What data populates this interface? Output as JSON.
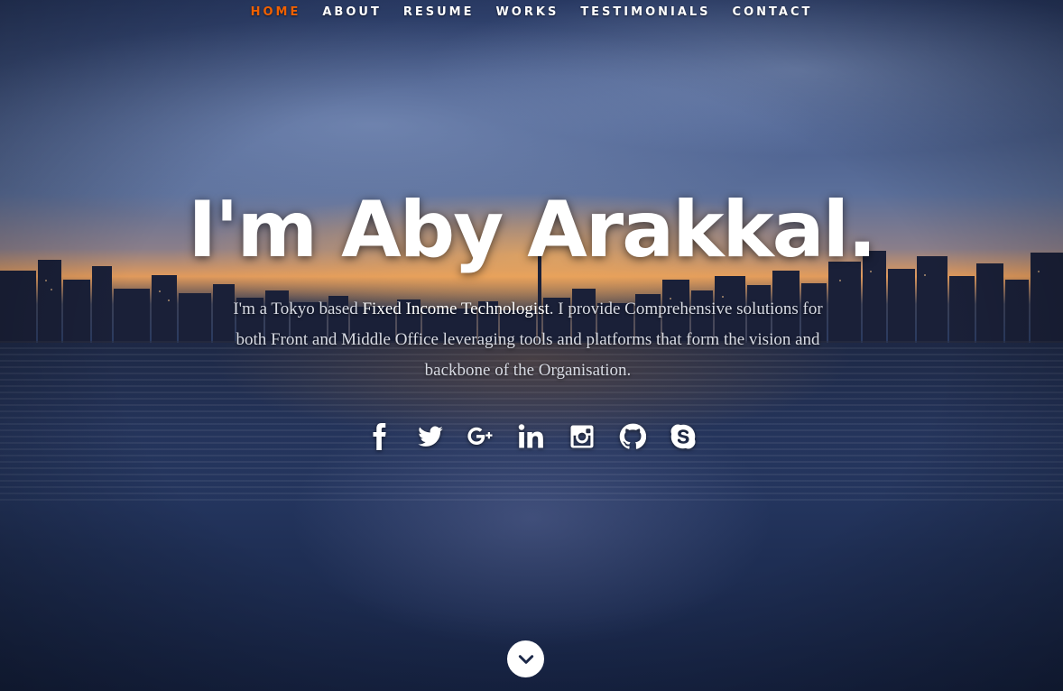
{
  "nav": {
    "items": [
      {
        "label": "HOME",
        "active": true
      },
      {
        "label": "ABOUT",
        "active": false
      },
      {
        "label": "RESUME",
        "active": false
      },
      {
        "label": "WORKS",
        "active": false
      },
      {
        "label": "TESTIMONIALS",
        "active": false
      },
      {
        "label": "CONTACT",
        "active": false
      }
    ],
    "active_color": "#f06000"
  },
  "banner": {
    "headline": "I'm Aby Arakkal.",
    "intro_before": "I'm a Tokyo based ",
    "intro_highlight": "Fixed Income Technologist",
    "intro_after": ". I provide Comprehensive solutions for both Front and Middle Office leveraging tools and platforms that form the vision and backbone of the Organisation."
  },
  "social": [
    {
      "icon": "facebook-icon"
    },
    {
      "icon": "twitter-icon"
    },
    {
      "icon": "google-plus-icon"
    },
    {
      "icon": "linkedin-icon"
    },
    {
      "icon": "instagram-icon"
    },
    {
      "icon": "github-icon"
    },
    {
      "icon": "skype-icon"
    }
  ],
  "scroll": {
    "icon": "chevron-down-icon"
  }
}
